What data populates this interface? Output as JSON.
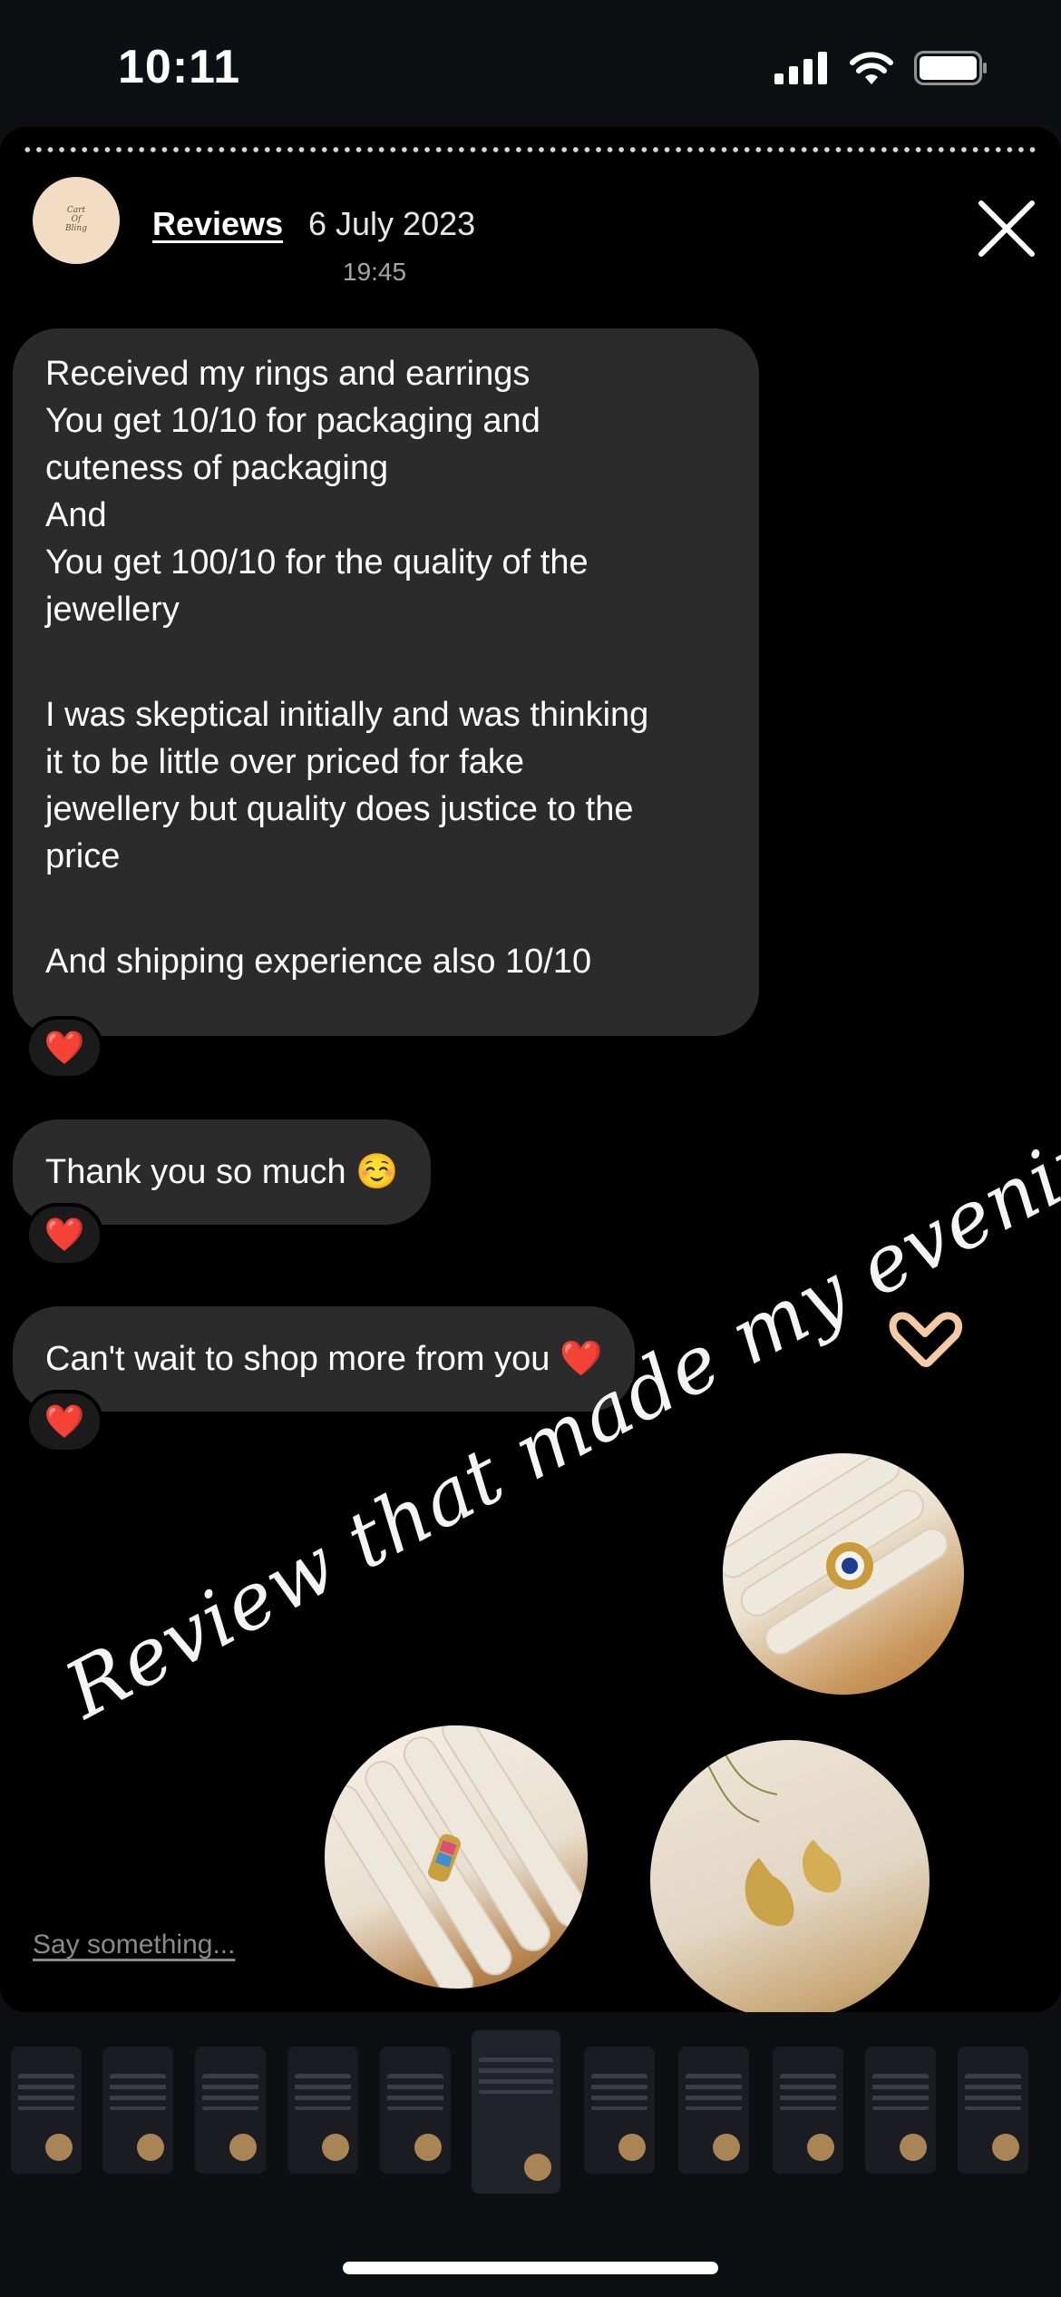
{
  "status_bar": {
    "time": "10:11"
  },
  "story": {
    "user": "Reviews",
    "date": "6 July 2023",
    "time": "19:45",
    "avatar_text": [
      "Cart",
      "Of",
      "Bling"
    ]
  },
  "messages": [
    {
      "lines": [
        "Received my rings and earrings",
        "You get 10/10 for packaging and",
        "cuteness of packaging",
        "And",
        "You get 100/10 for the quality of the",
        "jewellery",
        "",
        "I was skeptical initially and was thinking",
        "it to be little over priced for fake",
        "jewellery but quality does justice to the",
        "price",
        "",
        "And shipping experience also 10/10"
      ],
      "reaction": "❤️"
    },
    {
      "text": "Thank you so much ☺️",
      "reaction": "❤️"
    },
    {
      "text": "Can't wait to shop more from you ❤️",
      "reaction": "❤️"
    }
  ],
  "caption": "Review that made my evening",
  "caption_emoji": "🫶",
  "reply_placeholder": "Say something...",
  "colors": {
    "background": "#000000",
    "bubble": "#2b2b2b",
    "heart": "#e8283a"
  },
  "icons": [
    "signal-icon",
    "wifi-icon",
    "battery-icon",
    "close-icon",
    "heart-icon"
  ]
}
